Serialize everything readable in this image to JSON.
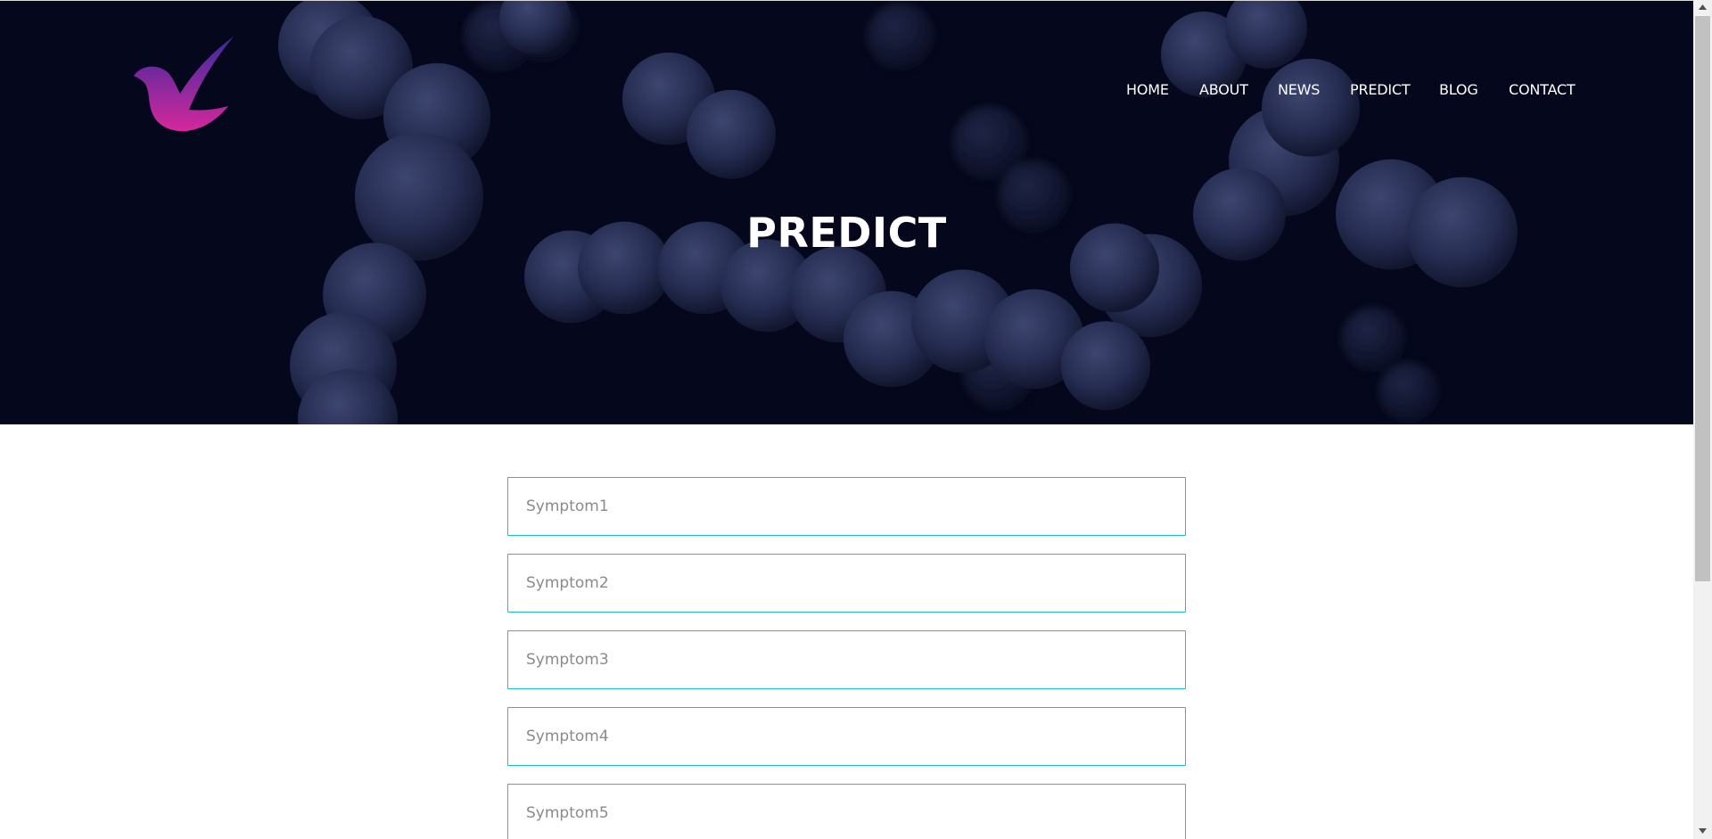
{
  "nav": {
    "items": [
      {
        "label": "HOME"
      },
      {
        "label": "ABOUT"
      },
      {
        "label": "NEWS"
      },
      {
        "label": "PREDICT"
      },
      {
        "label": "BLOG"
      },
      {
        "label": "CONTACT"
      }
    ]
  },
  "hero": {
    "title": "PREDICT"
  },
  "form": {
    "fields": [
      {
        "placeholder": "Symptom1",
        "value": ""
      },
      {
        "placeholder": "Symptom2",
        "value": ""
      },
      {
        "placeholder": "Symptom3",
        "value": ""
      },
      {
        "placeholder": "Symptom4",
        "value": ""
      },
      {
        "placeholder": "Symptom5",
        "value": ""
      }
    ]
  },
  "icons": {
    "logo": "bird-check-logo",
    "scroll_up": "triangle-up-icon",
    "scroll_down": "triangle-down-icon"
  },
  "colors": {
    "hero_background": "#05081c",
    "field_border": "#1fbfbb",
    "logo_gradient_top": "#3a2a9e",
    "logo_gradient_bottom": "#d6289c"
  }
}
